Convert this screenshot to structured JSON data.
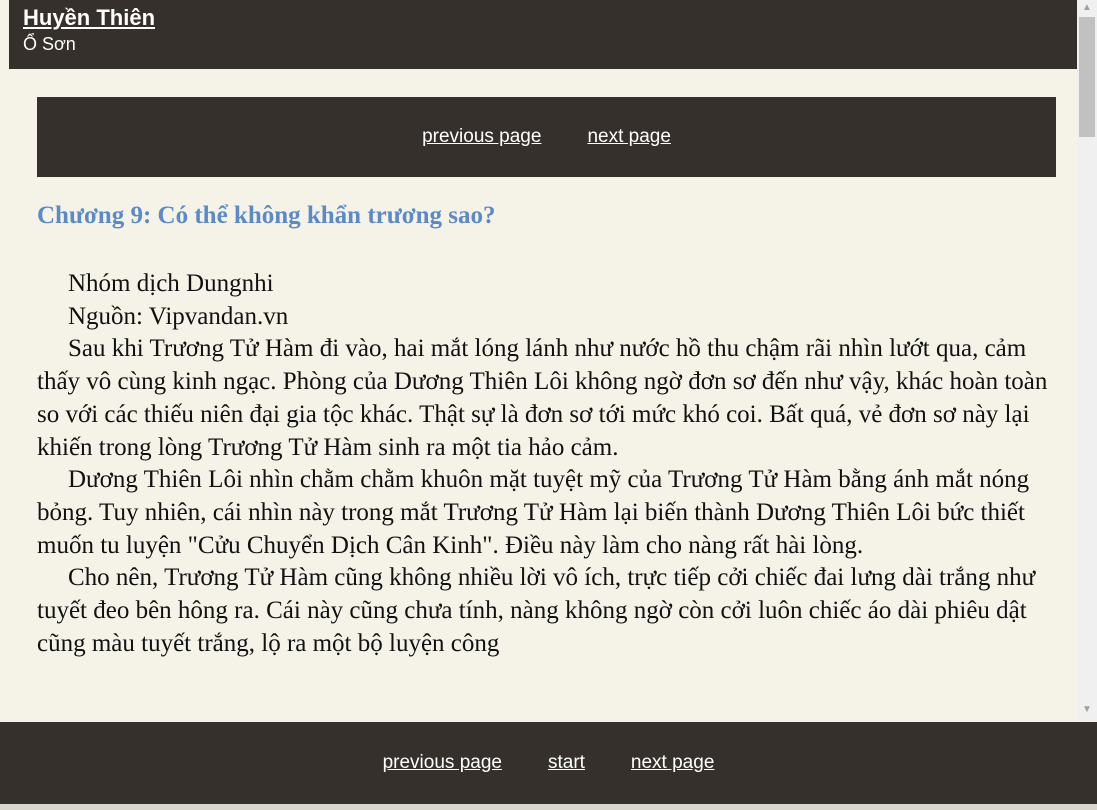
{
  "header": {
    "title": "Huyền Thiên",
    "author": "Ổ Sơn"
  },
  "top_nav": {
    "previous_label": "previous page",
    "next_label": "next page"
  },
  "chapter": {
    "title": "Chương 9: Có thể không khẩn trương sao?",
    "paragraphs": [
      "Nhóm dịch Dungnhi",
      "Nguồn: Vipvandan.vn",
      "Sau khi Trương Tử Hàm đi vào, hai mắt lóng lánh như nước hồ thu chậm rãi nhìn lướt qua, cảm thấy vô cùng kinh ngạc. Phòng của Dương Thiên Lôi không ngờ đơn sơ đến như vậy, khác hoàn toàn so với các thiếu niên đại gia tộc khác. Thật sự là đơn sơ tới mức khó coi. Bất quá, vẻ đơn sơ này lại khiến trong lòng Trương Tử Hàm sinh ra một tia hảo cảm.",
      "Dương Thiên Lôi nhìn chằm chằm khuôn mặt tuyệt mỹ của Trương Tử Hàm bằng ánh mắt nóng bỏng. Tuy nhiên, cái nhìn này trong mắt Trương Tử Hàm lại biến thành Dương Thiên Lôi bức thiết muốn tu luyện \"Cửu Chuyển Dịch Cân Kinh\". Điều này làm cho nàng rất hài lòng.",
      "Cho nên, Trương Tử Hàm cũng không nhiều lời vô ích, trực tiếp cởi chiếc đai lưng dài trắng như tuyết đeo bên hông ra. Cái này cũng chưa tính, nàng không ngờ còn cởi luôn chiếc áo dài phiêu dật cũng màu tuyết trắng, lộ ra một bộ luyện công"
    ]
  },
  "bottom_nav": {
    "previous_label": "previous page",
    "start_label": "start",
    "next_label": "next page"
  },
  "colors": {
    "bar_background": "#35302b",
    "page_background": "#f5f3e8",
    "chapter_title": "#5b8ac7"
  }
}
